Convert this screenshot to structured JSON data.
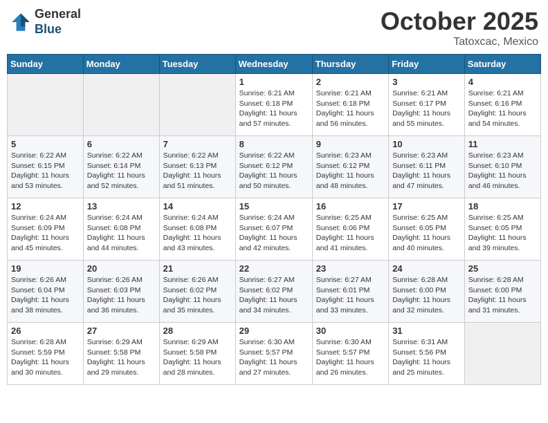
{
  "header": {
    "logo": {
      "general": "General",
      "blue": "Blue"
    },
    "title": "October 2025",
    "location": "Tatoxcac, Mexico"
  },
  "weekdays": [
    "Sunday",
    "Monday",
    "Tuesday",
    "Wednesday",
    "Thursday",
    "Friday",
    "Saturday"
  ],
  "weeks": [
    [
      {
        "day": "",
        "info": ""
      },
      {
        "day": "",
        "info": ""
      },
      {
        "day": "",
        "info": ""
      },
      {
        "day": "1",
        "info": "Sunrise: 6:21 AM\nSunset: 6:18 PM\nDaylight: 11 hours\nand 57 minutes."
      },
      {
        "day": "2",
        "info": "Sunrise: 6:21 AM\nSunset: 6:18 PM\nDaylight: 11 hours\nand 56 minutes."
      },
      {
        "day": "3",
        "info": "Sunrise: 6:21 AM\nSunset: 6:17 PM\nDaylight: 11 hours\nand 55 minutes."
      },
      {
        "day": "4",
        "info": "Sunrise: 6:21 AM\nSunset: 6:16 PM\nDaylight: 11 hours\nand 54 minutes."
      }
    ],
    [
      {
        "day": "5",
        "info": "Sunrise: 6:22 AM\nSunset: 6:15 PM\nDaylight: 11 hours\nand 53 minutes."
      },
      {
        "day": "6",
        "info": "Sunrise: 6:22 AM\nSunset: 6:14 PM\nDaylight: 11 hours\nand 52 minutes."
      },
      {
        "day": "7",
        "info": "Sunrise: 6:22 AM\nSunset: 6:13 PM\nDaylight: 11 hours\nand 51 minutes."
      },
      {
        "day": "8",
        "info": "Sunrise: 6:22 AM\nSunset: 6:12 PM\nDaylight: 11 hours\nand 50 minutes."
      },
      {
        "day": "9",
        "info": "Sunrise: 6:23 AM\nSunset: 6:12 PM\nDaylight: 11 hours\nand 48 minutes."
      },
      {
        "day": "10",
        "info": "Sunrise: 6:23 AM\nSunset: 6:11 PM\nDaylight: 11 hours\nand 47 minutes."
      },
      {
        "day": "11",
        "info": "Sunrise: 6:23 AM\nSunset: 6:10 PM\nDaylight: 11 hours\nand 46 minutes."
      }
    ],
    [
      {
        "day": "12",
        "info": "Sunrise: 6:24 AM\nSunset: 6:09 PM\nDaylight: 11 hours\nand 45 minutes."
      },
      {
        "day": "13",
        "info": "Sunrise: 6:24 AM\nSunset: 6:08 PM\nDaylight: 11 hours\nand 44 minutes."
      },
      {
        "day": "14",
        "info": "Sunrise: 6:24 AM\nSunset: 6:08 PM\nDaylight: 11 hours\nand 43 minutes."
      },
      {
        "day": "15",
        "info": "Sunrise: 6:24 AM\nSunset: 6:07 PM\nDaylight: 11 hours\nand 42 minutes."
      },
      {
        "day": "16",
        "info": "Sunrise: 6:25 AM\nSunset: 6:06 PM\nDaylight: 11 hours\nand 41 minutes."
      },
      {
        "day": "17",
        "info": "Sunrise: 6:25 AM\nSunset: 6:05 PM\nDaylight: 11 hours\nand 40 minutes."
      },
      {
        "day": "18",
        "info": "Sunrise: 6:25 AM\nSunset: 6:05 PM\nDaylight: 11 hours\nand 39 minutes."
      }
    ],
    [
      {
        "day": "19",
        "info": "Sunrise: 6:26 AM\nSunset: 6:04 PM\nDaylight: 11 hours\nand 38 minutes."
      },
      {
        "day": "20",
        "info": "Sunrise: 6:26 AM\nSunset: 6:03 PM\nDaylight: 11 hours\nand 36 minutes."
      },
      {
        "day": "21",
        "info": "Sunrise: 6:26 AM\nSunset: 6:02 PM\nDaylight: 11 hours\nand 35 minutes."
      },
      {
        "day": "22",
        "info": "Sunrise: 6:27 AM\nSunset: 6:02 PM\nDaylight: 11 hours\nand 34 minutes."
      },
      {
        "day": "23",
        "info": "Sunrise: 6:27 AM\nSunset: 6:01 PM\nDaylight: 11 hours\nand 33 minutes."
      },
      {
        "day": "24",
        "info": "Sunrise: 6:28 AM\nSunset: 6:00 PM\nDaylight: 11 hours\nand 32 minutes."
      },
      {
        "day": "25",
        "info": "Sunrise: 6:28 AM\nSunset: 6:00 PM\nDaylight: 11 hours\nand 31 minutes."
      }
    ],
    [
      {
        "day": "26",
        "info": "Sunrise: 6:28 AM\nSunset: 5:59 PM\nDaylight: 11 hours\nand 30 minutes."
      },
      {
        "day": "27",
        "info": "Sunrise: 6:29 AM\nSunset: 5:58 PM\nDaylight: 11 hours\nand 29 minutes."
      },
      {
        "day": "28",
        "info": "Sunrise: 6:29 AM\nSunset: 5:58 PM\nDaylight: 11 hours\nand 28 minutes."
      },
      {
        "day": "29",
        "info": "Sunrise: 6:30 AM\nSunset: 5:57 PM\nDaylight: 11 hours\nand 27 minutes."
      },
      {
        "day": "30",
        "info": "Sunrise: 6:30 AM\nSunset: 5:57 PM\nDaylight: 11 hours\nand 26 minutes."
      },
      {
        "day": "31",
        "info": "Sunrise: 6:31 AM\nSunset: 5:56 PM\nDaylight: 11 hours\nand 25 minutes."
      },
      {
        "day": "",
        "info": ""
      }
    ]
  ]
}
